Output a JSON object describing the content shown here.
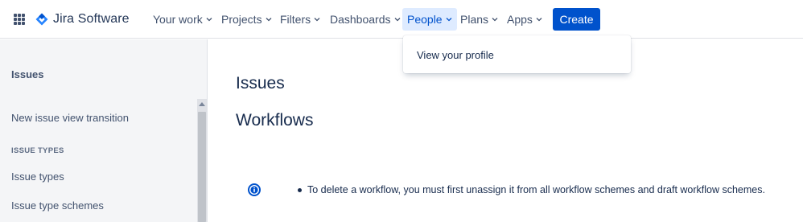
{
  "app": {
    "name": "Jira Software"
  },
  "nav": {
    "items": [
      {
        "label": "Your work"
      },
      {
        "label": "Projects"
      },
      {
        "label": "Filters"
      },
      {
        "label": "Dashboards"
      },
      {
        "label": "People"
      },
      {
        "label": "Plans"
      },
      {
        "label": "Apps"
      }
    ],
    "active": "People",
    "create_label": "Create"
  },
  "people_menu": {
    "items": [
      {
        "label": "View your profile"
      }
    ]
  },
  "sidebar": {
    "heading": "Issues",
    "items": [
      {
        "label": "New issue view transition"
      }
    ],
    "group": {
      "title": "ISSUE TYPES",
      "items": [
        {
          "label": "Issue types"
        },
        {
          "label": "Issue type schemes"
        }
      ]
    }
  },
  "main": {
    "title": "Issues",
    "section_title": "Workflows",
    "notice": "To delete a workflow, you must first unassign it from all workflow schemes and draft workflow schemes."
  },
  "colors": {
    "brand": "#0052cc",
    "nav_active_bg": "#deebff",
    "sidebar_bg": "#f4f5f7",
    "info_icon": "#0052cc"
  },
  "icons": {
    "app_switcher": "grid-icon",
    "logo": "jira-diamond-icon",
    "dropdown": "chevron-down-icon",
    "notice": "info-icon"
  }
}
